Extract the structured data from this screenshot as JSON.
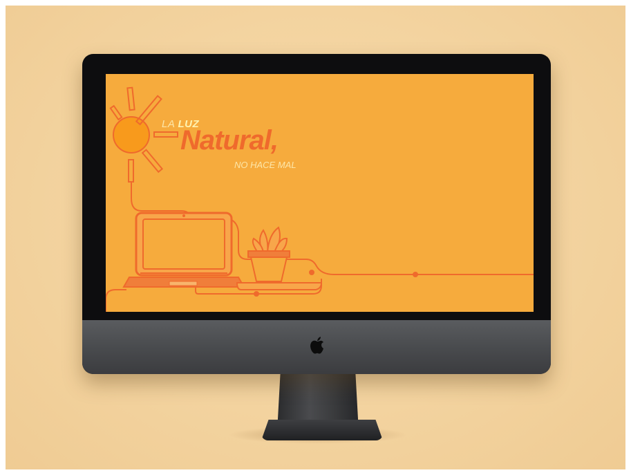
{
  "scene": {
    "background_color": "#f3d39f",
    "device": "desktop-monitor"
  },
  "wallpaper": {
    "background_color": "#f6ab3d",
    "accent_color": "#ef6a2c",
    "light_text_color": "#fde6a8",
    "headline": {
      "prefix": "LA ",
      "highlight": "LUZ",
      "main": "Natural,",
      "tagline": "NO HACE MAL"
    },
    "illustration": [
      "sun-icon",
      "laptop-icon",
      "plant-pot-icon",
      "cable-line"
    ]
  },
  "monitor": {
    "logo": "apple-logo-icon"
  }
}
